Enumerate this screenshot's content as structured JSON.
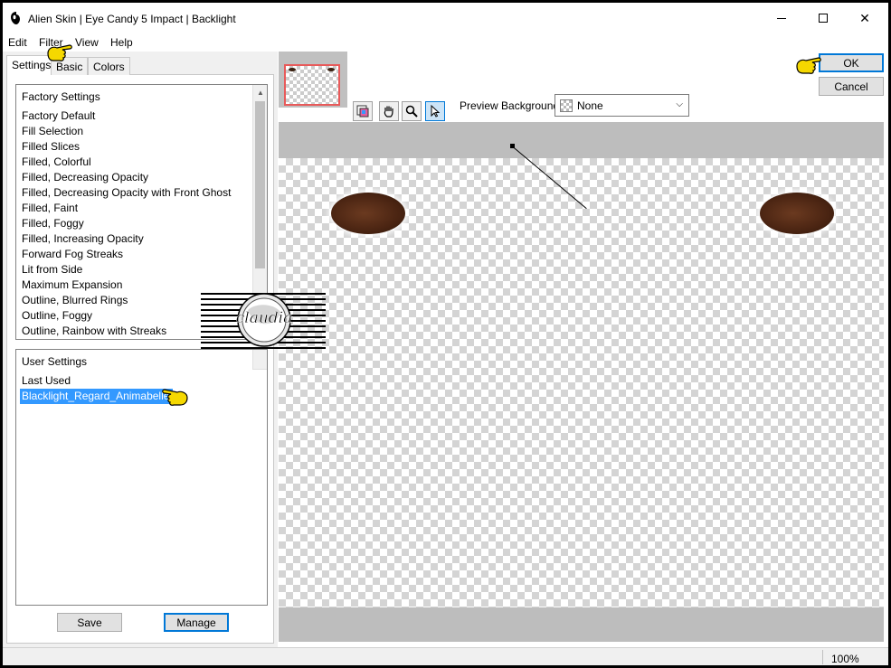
{
  "window": {
    "title": "Alien Skin | Eye Candy 5 Impact | Backlight"
  },
  "menu": {
    "items": [
      "Edit",
      "Filter",
      "View",
      "Help"
    ]
  },
  "tabs": [
    "Settings",
    "Basic",
    "Colors"
  ],
  "factory_settings": {
    "header": "Factory Settings",
    "items": [
      "Factory Default",
      "Fill Selection",
      "Filled Slices",
      "Filled, Colorful",
      "Filled, Decreasing Opacity",
      "Filled, Decreasing Opacity with Front Ghost",
      "Filled, Faint",
      "Filled, Foggy",
      "Filled, Increasing Opacity",
      "Forward Fog Streaks",
      "Lit from Side",
      "Maximum Expansion",
      "Outline, Blurred Rings",
      "Outline, Foggy",
      "Outline, Rainbow with Streaks"
    ]
  },
  "user_settings": {
    "header": "User Settings",
    "items": [
      "Last Used",
      "Blacklight_Regard_Animabelle"
    ],
    "selected": "Blacklight_Regard_Animabelle"
  },
  "buttons": {
    "save": "Save",
    "manage": "Manage",
    "ok": "OK",
    "cancel": "Cancel"
  },
  "preview": {
    "label": "Preview Background:",
    "value": "None"
  },
  "status": {
    "zoom": "100%"
  },
  "watermark": {
    "text": "claudia"
  },
  "colors": {
    "accent": "#0078d7",
    "selection": "#3399ff",
    "hand": "#f5d800"
  }
}
